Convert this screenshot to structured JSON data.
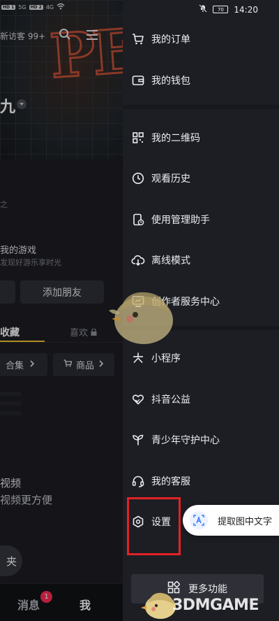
{
  "status_left": {
    "hd1": "HD 1",
    "hd2": "HD 2",
    "net": "5G",
    "net2": "4G"
  },
  "status_right": {
    "battery": "70",
    "time": "14:20"
  },
  "profile": {
    "visitor_text": "新访客 99+",
    "name_fragment": "九",
    "bio_fragment": "之",
    "game_title": "我的游戏",
    "game_sub": "发现好游乐享时光",
    "add_friend": "添加朋友",
    "tab_favorites": "收藏",
    "tab_likes": "喜欢",
    "chip_collection": "合集",
    "chip_goods": "商品",
    "video_title": "视频",
    "video_sub": "视频更方便",
    "open_pill": "夹"
  },
  "bottom_nav": {
    "messages": "消息",
    "messages_badge": "1",
    "me": "我"
  },
  "menu": [
    {
      "label": "我的订单",
      "icon": "cart-icon"
    },
    {
      "label": "我的钱包",
      "icon": "wallet-icon"
    },
    {
      "label": "我的二维码",
      "icon": "qr-code-icon"
    },
    {
      "label": "观看历史",
      "icon": "clock-icon"
    },
    {
      "label": "使用管理助手",
      "icon": "phone-timer-icon"
    },
    {
      "label": "离线模式",
      "icon": "cloud-download-icon"
    },
    {
      "label": "创作者服务中心",
      "icon": "chart-board-icon"
    },
    {
      "label": "小程序",
      "icon": "asterisk-icon"
    },
    {
      "label": "抖音公益",
      "icon": "heart-hands-icon"
    },
    {
      "label": "青少年守护中心",
      "icon": "sprout-icon"
    },
    {
      "label": "我的客服",
      "icon": "headset-icon"
    },
    {
      "label": "设置",
      "icon": "hexagon-gear-icon"
    }
  ],
  "ocr_button": {
    "label": "提取图中文字",
    "icon": "ocr-icon"
  },
  "more_button": {
    "label": "更多功能",
    "icon": "grid-icon"
  },
  "watermark": {
    "text": "3DMGAME"
  },
  "colors": {
    "highlight": "#e22226",
    "drawer_bg": "#1d1e24",
    "tab_accent": "#f6c42c",
    "badge": "#fe2c55"
  }
}
